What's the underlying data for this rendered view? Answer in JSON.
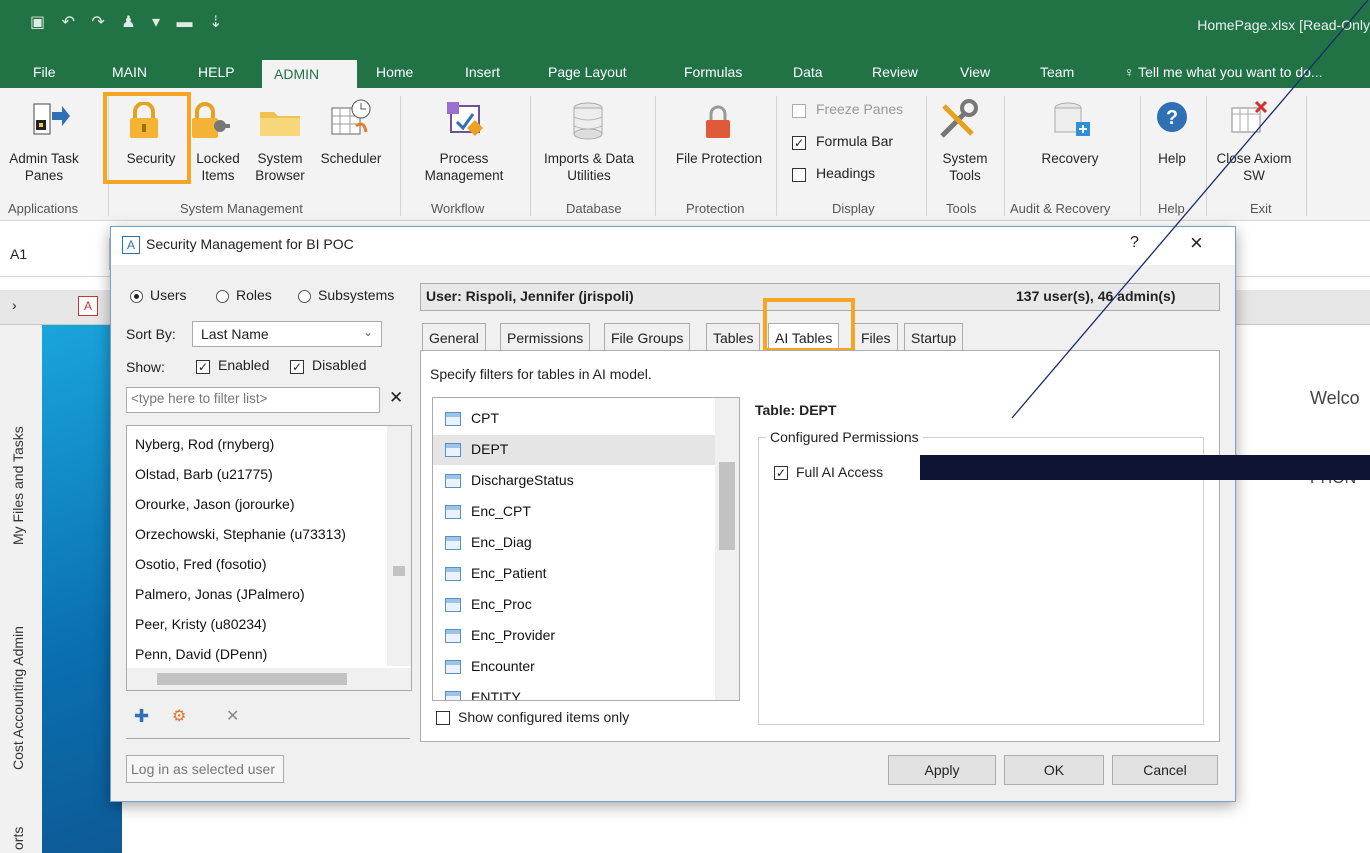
{
  "window": {
    "title": "HomePage.xlsx  [Read-Only"
  },
  "ribbon_tabs": [
    "File",
    "MAIN",
    "HELP",
    "ADMIN",
    "Home",
    "Insert",
    "Page Layout",
    "Formulas",
    "Data",
    "Review",
    "View",
    "Team"
  ],
  "tell_me": "Tell me what you want to do...",
  "ribbon": {
    "admin_task_panes": "Admin Task Panes",
    "security": "Security",
    "locked_items": "Locked Items",
    "system_browser": "System Browser",
    "scheduler": "Scheduler",
    "process_management": "Process Management",
    "imports_data": "Imports & Data Utilities",
    "file_protection": "File Protection",
    "freeze_panes": "Freeze Panes",
    "formula_bar": "Formula Bar",
    "headings": "Headings",
    "system_tools": "System Tools",
    "recovery": "Recovery",
    "help": "Help",
    "close": "Close Axiom SW",
    "groups": [
      "Applications",
      "System Management",
      "Workflow",
      "Database",
      "Protection",
      "Display",
      "Tools",
      "Audit & Recovery",
      "Help",
      "Exit"
    ]
  },
  "name_box": "A1",
  "side_tabs": [
    "My Files and Tasks",
    "Cost Accounting Admin",
    "orts"
  ],
  "sheet": {
    "welcome": "Welco",
    "phone": "PHON"
  },
  "dialog": {
    "title": "Security Management for BI POC",
    "help": "?",
    "close": "×",
    "radios": [
      "Users",
      "Roles",
      "Subsystems"
    ],
    "sort_by_label": "Sort By:",
    "sort_by_value": "Last Name",
    "show_label": "Show:",
    "enabled": "Enabled",
    "disabled": "Disabled",
    "filter_placeholder": "<type here to filter list>",
    "users": [
      "Nyberg, Rod (rnyberg)",
      "Olstad, Barb (u21775)",
      "Orourke, Jason (jorourke)",
      "Orzechowski, Stephanie (u73313)",
      "Osotio, Fred (fosotio)",
      "Palmero, Jonas (JPalmero)",
      "Peer, Kristy (u80234)",
      "Penn, David (DPenn)"
    ],
    "login_as": "Log in as selected user",
    "user_header": "User: Rispoli, Jennifer (jrispoli)",
    "user_count": "137 user(s), 46 admin(s)",
    "tabs": [
      "General",
      "Permissions",
      "File Groups",
      "Tables",
      "AI Tables",
      "Files",
      "Startup"
    ],
    "filter_desc": "Specify filters for tables in AI model.",
    "tables": [
      "CPT",
      "DEPT",
      "DischargeStatus",
      "Enc_CPT",
      "Enc_Diag",
      "Enc_Patient",
      "Enc_Proc",
      "Enc_Provider",
      "Encounter",
      "ENTITY"
    ],
    "show_configured": "Show configured items only",
    "table_label": "Table: DEPT",
    "configured_permissions": "Configured Permissions",
    "full_ai_access": "Full AI Access",
    "apply": "Apply",
    "ok": "OK",
    "cancel": "Cancel"
  },
  "colors": {
    "excel_green": "#217346",
    "highlight": "#f5a524",
    "redaction": "#0f1432"
  }
}
